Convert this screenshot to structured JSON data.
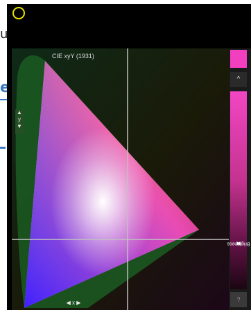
{
  "background": {
    "letter_u": "u",
    "letter_e": "e"
  },
  "chart": {
    "title": "CIE xyY (1931)",
    "y_axis_label": "y",
    "x_axis_label": "x",
    "crosshair_x": 0.5,
    "crosshair_y": 0.22
  },
  "sidebar": {
    "swatch_color": "#f23fbf",
    "up_label": "^",
    "brightness_label": "Brightness",
    "help_label": "?"
  },
  "colors": {
    "gamut_red": "#ff0040",
    "gamut_green": "#00ff00",
    "gamut_blue": "#3030ff",
    "crosshair": "#c0c0c0"
  }
}
